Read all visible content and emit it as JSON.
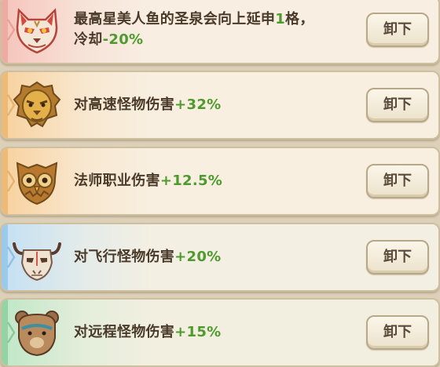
{
  "relics": [
    {
      "icon": "fox-mask-icon",
      "line1": "最高星美人鱼的圣泉会向上延申",
      "line1_num": "1",
      "line1_suffix": "格，",
      "line2": "冷却",
      "line2_num": "-20%",
      "button": "卸下",
      "accent": "#e05a4a"
    },
    {
      "icon": "lion-mask-icon",
      "text": "对高速怪物伤害",
      "num": "+32%",
      "button": "卸下",
      "accent": "#e9a23a"
    },
    {
      "icon": "owl-mask-icon",
      "text": "法师职业伤害",
      "num": "+12.5%",
      "button": "卸下",
      "accent": "#e9a23a"
    },
    {
      "icon": "bull-skull-icon",
      "text": "对飞行怪物伤害",
      "num": "+20%",
      "button": "卸下",
      "accent": "#6fb6e6"
    },
    {
      "icon": "bear-mask-icon",
      "text": "对远程怪物伤害",
      "num": "+15%",
      "button": "卸下",
      "accent": "#6fc08a"
    }
  ],
  "colors": {
    "text": "#4a3a2a",
    "value_green": "#4f9a2e",
    "card_bg": "#f7efde",
    "page_bg": "#dcd0b8"
  }
}
